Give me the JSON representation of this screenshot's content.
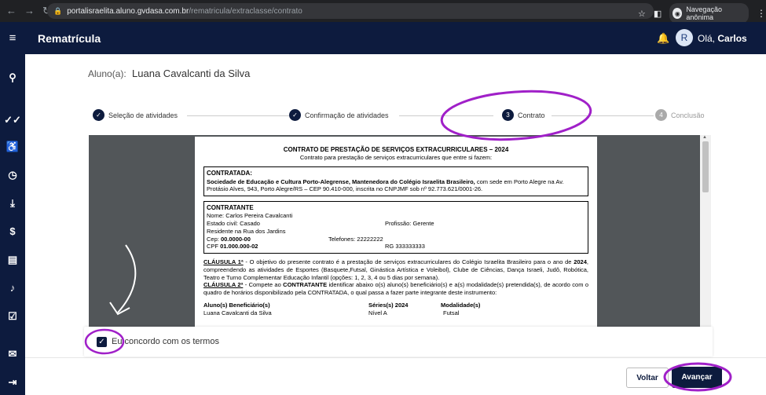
{
  "browser": {
    "url_host": "portalisraelita.aluno.gvdasa.com.br",
    "url_path": "/rematricula/extraclasse/contrato",
    "incognito_label": "Navegação anônima"
  },
  "header": {
    "title": "Rematrícula",
    "avatar_initial": "R",
    "greeting": "Olá,",
    "user_name": "Carlos"
  },
  "student": {
    "label": "Aluno(a):",
    "name": "Luana Cavalcanti da Silva"
  },
  "steps": [
    {
      "number": "",
      "label": "Seleção de atividades",
      "status": "done"
    },
    {
      "number": "",
      "label": "Confirmação de atividades",
      "status": "done"
    },
    {
      "number": "3",
      "label": "Contrato",
      "status": "current"
    },
    {
      "number": "4",
      "label": "Conclusão",
      "status": "pending"
    }
  ],
  "contract": {
    "title": "CONTRATO DE PRESTAÇÃO DE SERVIÇOS EXTRACURRICULARES – 2024",
    "subtitle": "Contrato para prestação de serviços extracurriculares que entre si fazem:",
    "contratada_header": "CONTRATADA:",
    "contratada_name": "Sociedade de Educação e Cultura Porto-Alegrense, Mantenedora do Colégio Israelita Brasileiro,",
    "contratada_rest": " com sede em Porto Alegre na Av. Protásio Alves, 943, Porto Alegre/RS – CEP 90.410-000, inscrita no CNPJMF sob nº 92.773.621/0001-26.",
    "contratante_header": "CONTRATANTE",
    "nome_label": "Nome:",
    "nome_value": "Carlos Pereira Cavalcanti",
    "estado_label": "Estado civil:",
    "estado_value": "Casado",
    "profissao_label": "Profissão:",
    "profissao_value": "Gerente",
    "residente_label": "Residente na",
    "residente_value": "Rua dos Jardins",
    "cep_label": "Cep:",
    "cep_value": "00.0000-00",
    "telefones_label": "Telefones:",
    "telefones_value": "22222222",
    "cpf_label": "CPF",
    "cpf_value": "01.000.000-02",
    "rg_label": "RG",
    "rg_value": "333333333",
    "clause1_title": "CLÁUSULA 1ª",
    "clause1_text_a": " - O objetivo do presente contrato é a prestação de serviços extracurriculares do Colégio Israelita Brasileiro para o ano de ",
    "clause1_year": "2024",
    "clause1_text_b": ", compreendendo as atividades de Esportes (Basquete,Futsal, Ginástica Artística e Voleibol), Clube de Ciências, Dança Israeli, Judô, Robótica, Teatro e Turno Complementar Educação Infantil (opções: 1, 2, 3, 4 ou 5 dias por semana).",
    "clause2_title": "CLÁUSULA 2ª",
    "clause2_text_a": " - Compete ao ",
    "clause2_bold": "CONTRATANTE",
    "clause2_text_b": " identificar abaixo o(s) aluno(s) beneficiário(s) e a(s) modalidade(s) pretendida(s), de acordo com o quadro de horários disponibilizado pela CONTRATADA, o qual passa a fazer parte integrante deste instrumento:",
    "table_headers": [
      "Aluno(s) Beneficiário(s)",
      "Séries(s) 2024",
      "Modalidade(s)"
    ],
    "table_rows": [
      [
        "Luana Cavalcanti da Silva",
        "Nível A",
        "Futsal"
      ]
    ]
  },
  "agreement": {
    "checked": true,
    "label": "Eu concordo com os termos"
  },
  "actions": {
    "back_label": "Voltar",
    "next_label": "Avançar"
  },
  "colors": {
    "primary": "#0d1b3e",
    "annotation": "#a020c8"
  }
}
